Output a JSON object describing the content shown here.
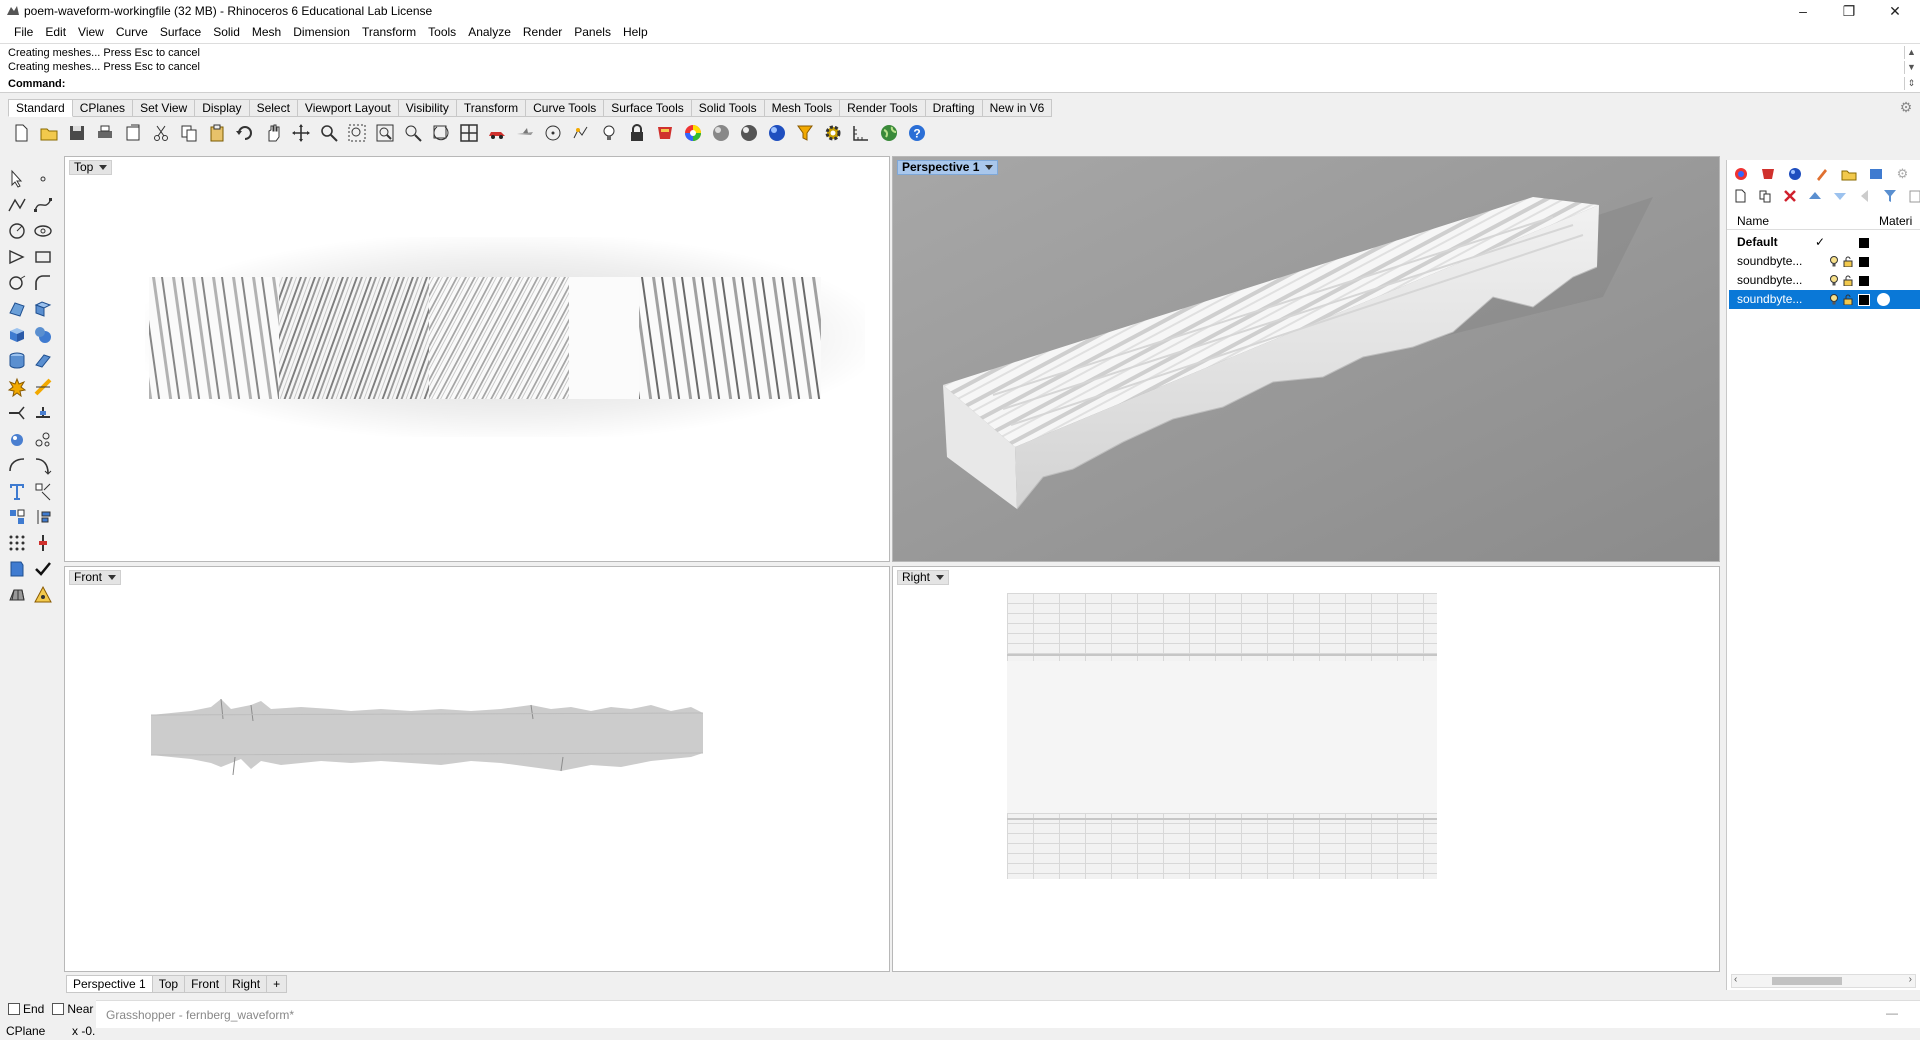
{
  "window": {
    "title": "poem-waveform-workingfile (32 MB) - Rhinoceros 6 Educational Lab License",
    "minimize": "–",
    "restore": "❐",
    "close": "✕"
  },
  "menu": [
    "File",
    "Edit",
    "View",
    "Curve",
    "Surface",
    "Solid",
    "Mesh",
    "Dimension",
    "Transform",
    "Tools",
    "Analyze",
    "Render",
    "Panels",
    "Help"
  ],
  "command": {
    "history": [
      "Creating meshes... Press Esc to cancel",
      "Creating meshes... Press Esc to cancel"
    ],
    "label": "Command:",
    "value": ""
  },
  "toolbar_tabs": [
    "Standard",
    "CPlanes",
    "Set View",
    "Display",
    "Select",
    "Viewport Layout",
    "Visibility",
    "Transform",
    "Curve Tools",
    "Surface Tools",
    "Solid Tools",
    "Mesh Tools",
    "Render Tools",
    "Drafting",
    "New in V6"
  ],
  "active_toolbar_tab": "Standard",
  "toolbar_icons": [
    "new-icon",
    "open-icon",
    "save-icon",
    "print-icon",
    "import-icon",
    "cut-icon",
    "copy-icon",
    "paste-icon",
    "undo-icon",
    "pan-icon",
    "move-icon",
    "zoom-icon",
    "zoom-window-icon",
    "zoom-extents-icon",
    "zoom-selected-icon",
    "rotate-view-icon",
    "four-viewports-icon",
    "car-icon",
    "plane-icon",
    "circle-icon",
    "point-icon",
    "light-icon",
    "lock-icon",
    "materials-icon",
    "color-wheel-icon",
    "shaded-icon",
    "rendered-icon",
    "render-icon",
    "filter-icon",
    "settings-icon",
    "grid-snap-icon",
    "globe-icon",
    "help-icon"
  ],
  "left_tools": [
    "select-arrow-icon",
    "point-icon",
    "polyline-icon",
    "curve-icon",
    "circle-icon",
    "arc-icon",
    "polygon-icon",
    "rectangle-icon",
    "ellipse-icon",
    "fillet-icon",
    "surface-icon",
    "extrude-icon",
    "box-icon",
    "sphere-icon",
    "cylinder-icon",
    "boolean-icon",
    "explode-icon",
    "trim-icon",
    "split-icon",
    "join-icon",
    "group-icon",
    "move-icon",
    "rotate-icon",
    "scale-icon",
    "text-icon",
    "dimension-icon",
    "array-icon",
    "align-icon",
    "mirror-icon",
    "check-icon",
    "mesh-icon",
    "analyze-icon"
  ],
  "viewports": {
    "top": {
      "label": "Top"
    },
    "perspective": {
      "label": "Perspective 1"
    },
    "front": {
      "label": "Front"
    },
    "right": {
      "label": "Right"
    }
  },
  "viewport_tabs": [
    "Perspective 1",
    "Top",
    "Front",
    "Right",
    "+"
  ],
  "layers": {
    "col_name": "Name",
    "col_material": "Materi",
    "rows": [
      {
        "name": "Default",
        "current": "✓",
        "color": "#000000"
      },
      {
        "name": "soundbyte...",
        "current": "",
        "color": "#000000"
      },
      {
        "name": "soundbyte...",
        "current": "",
        "color": "#000000"
      },
      {
        "name": "soundbyte...",
        "current": "",
        "color": "#000000"
      }
    ],
    "selected_index": 3
  },
  "status": {
    "osnaps": [
      "End",
      "Near"
    ],
    "cplane": "CPlane",
    "coord": "x -0.",
    "grasshopper": "Grasshopper - fernberg_waveform*",
    "gh_min": "—"
  },
  "colors": {
    "accent": "#0a78d7",
    "perspective_bg": "#9a9a9a"
  }
}
